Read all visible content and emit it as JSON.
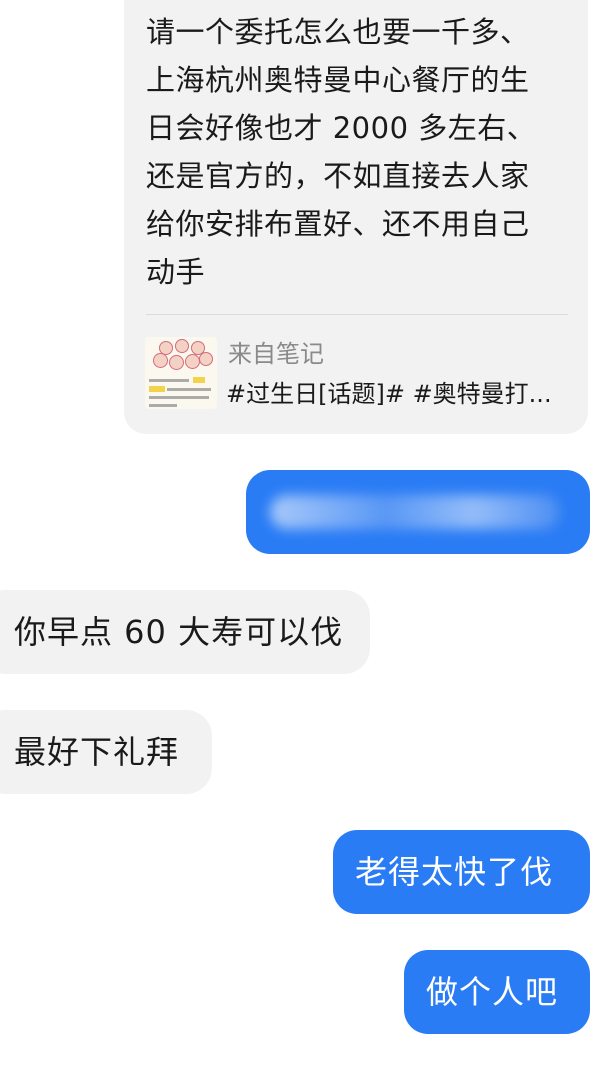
{
  "messages": {
    "received_note": {
      "text": "请一个委托怎么也要一千多、\n上海杭州奥特曼中心餐厅的生\n日会好像也才 2000 多左右、\n还是官方的，不如直接去人家\n给你安排布置好、还不用自己\n动手",
      "note_source_label": "来自笔记",
      "note_title": "#过生日[话题]# #奥特曼打..."
    },
    "sent_blurred": {
      "text": ""
    },
    "received_1": "你早点 60 大寿可以伐",
    "received_2": "最好下礼拜",
    "sent_1": "老得太快了伐",
    "sent_2": "做个人吧"
  },
  "colors": {
    "sent_bubble": "#2a7cf5",
    "received_bubble": "#f2f2f2",
    "background": "#ffffff",
    "text": "#1a1a1a",
    "muted_text": "#8a8a8a"
  },
  "icons": {
    "note_thumbnail": "note-thumbnail-image"
  }
}
